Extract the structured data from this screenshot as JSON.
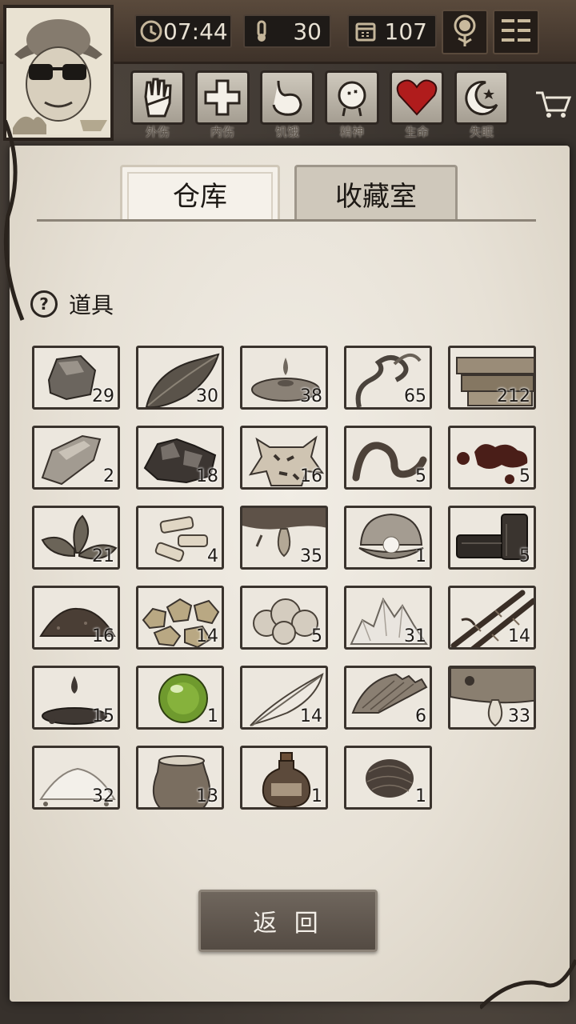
{
  "hud": {
    "time": "07:44",
    "temperature": "30",
    "day": "107"
  },
  "status": [
    {
      "label": "外伤",
      "icon": "hand-icon"
    },
    {
      "label": "内伤",
      "icon": "cross-icon"
    },
    {
      "label": "饥饿",
      "icon": "stomach-icon"
    },
    {
      "label": "精神",
      "icon": "head-icon"
    },
    {
      "label": "生命",
      "icon": "heart-icon"
    },
    {
      "label": "失眠",
      "icon": "moon-icon"
    }
  ],
  "tabs": {
    "storage": "仓库",
    "collection": "收藏室"
  },
  "section": {
    "title": "道具"
  },
  "items": [
    {
      "name": "stone",
      "count": "29"
    },
    {
      "name": "leaf",
      "count": "30"
    },
    {
      "name": "water",
      "count": "38"
    },
    {
      "name": "vine",
      "count": "65"
    },
    {
      "name": "wood-planks",
      "count": "212"
    },
    {
      "name": "flint",
      "count": "2"
    },
    {
      "name": "ore",
      "count": "18"
    },
    {
      "name": "animal-hide",
      "count": "16"
    },
    {
      "name": "worm",
      "count": "5"
    },
    {
      "name": "blood",
      "count": "5"
    },
    {
      "name": "herb",
      "count": "21"
    },
    {
      "name": "bone-pieces",
      "count": "4"
    },
    {
      "name": "resin",
      "count": "35"
    },
    {
      "name": "pearl-shell",
      "count": "1"
    },
    {
      "name": "charcoal",
      "count": "5"
    },
    {
      "name": "soil",
      "count": "16"
    },
    {
      "name": "gold-nuggets",
      "count": "14"
    },
    {
      "name": "cotton",
      "count": "5"
    },
    {
      "name": "salt-crystal",
      "count": "31"
    },
    {
      "name": "bamboo",
      "count": "14"
    },
    {
      "name": "oil-drop",
      "count": "15"
    },
    {
      "name": "green-orb",
      "count": "1"
    },
    {
      "name": "feather",
      "count": "14"
    },
    {
      "name": "fin",
      "count": "6"
    },
    {
      "name": "fish-oil",
      "count": "33"
    },
    {
      "name": "flour",
      "count": "32"
    },
    {
      "name": "grain-sack",
      "count": "13"
    },
    {
      "name": "potion-bottle",
      "count": "1"
    },
    {
      "name": "fiber-ball",
      "count": "1"
    }
  ],
  "back_button": "返 回",
  "colors": {
    "paper": "#ece7de",
    "slot_border": "#3a332d",
    "heart": "#b01c1c",
    "button": "#5f564d"
  }
}
